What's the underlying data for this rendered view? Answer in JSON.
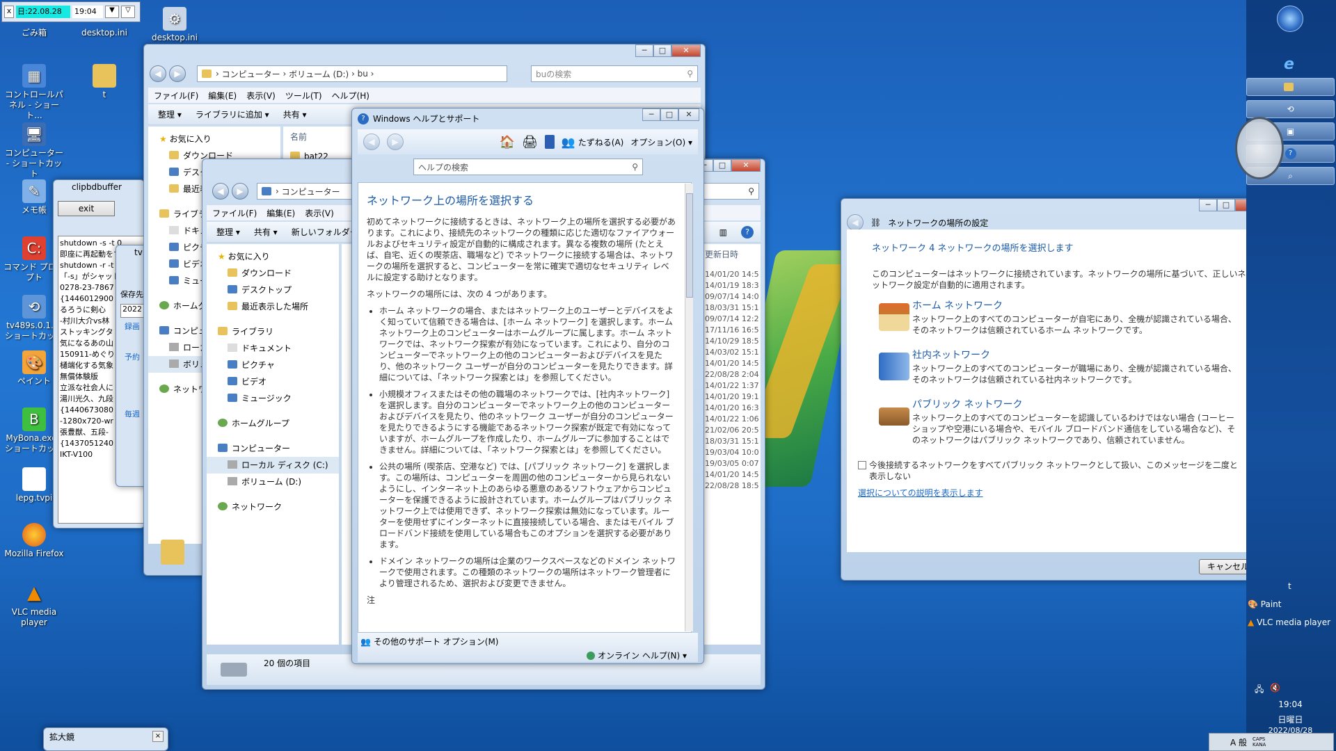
{
  "desktop": {
    "topbar": {
      "x_label": "x",
      "date": "日:22.08.28",
      "time": "19:04"
    },
    "icons": [
      {
        "label": "ごみ箱"
      },
      {
        "label": "desktop.ini"
      },
      {
        "label": "desktop.ini"
      },
      {
        "label": "コントロールパネル - ショート..."
      },
      {
        "label": "t"
      },
      {
        "label": "コンピューター - ショートカット"
      },
      {
        "label": "メモ帳"
      },
      {
        "label": "コマンド プロンプト"
      },
      {
        "label": "tv489s.0.1.. - ショートカット"
      },
      {
        "label": "ペイント"
      },
      {
        "label": "MyBona.exe - ショートカット"
      },
      {
        "label": "lepg.tvpi"
      },
      {
        "label": "Mozilla Firefox"
      },
      {
        "label": "VLC media player"
      }
    ]
  },
  "clip": {
    "title": "clipbdbuffer",
    "exit": "exit",
    "lines": [
      "shutdown -s -t 0",
      "即座に再起動をす",
      "shutdown -r -t 0",
      "「-s」がシャット",
      "0278-23-7867",
      "{1446012900",
      "るろうに剣心",
      "-村川大介vs林",
      "ストッキングタ",
      "気になるあの山",
      "150911-めぐり",
      "樋端化する気象",
      "無償体験版",
      "立派な社会人に",
      "湯川光久、九段",
      "{1440673080",
      "-1280x720-wr",
      "張豊猷、五段-",
      "{1437051240",
      "IKT-V100"
    ]
  },
  "tv": {
    "title": "tv",
    "hozon": "保存先",
    "year": "2022",
    "rokuga": "録画",
    "yoyaku": "予約",
    "maishu": "毎週"
  },
  "explorer1": {
    "path": [
      "コンピューター",
      "ボリューム (D:)",
      "bu"
    ],
    "search": "buの検索",
    "menu": [
      "ファイル(F)",
      "編集(E)",
      "表示(V)",
      "ツール(T)",
      "ヘルプ(H)"
    ],
    "cmd": [
      "整理 ▾",
      "ライブラリに追加 ▾",
      "共有 ▾"
    ],
    "nav": [
      "お気に入り",
      "ダウンロード",
      "デスクトップ",
      "最近表示した場所",
      "ライブラリ",
      "ドキュメント",
      "ピクチャ",
      "ビデオ",
      "ミュージック",
      "ホームグループ",
      "コンピューター",
      "ローカル ディスク (C:)",
      "ボリューム (D:)",
      "ネットワーク"
    ],
    "col": "名前",
    "file": "bat22"
  },
  "explorer2": {
    "path": "コンピューター",
    "menu": [
      "ファイル(F)",
      "編集(E)",
      "表示(V)"
    ],
    "cmd": [
      "整理 ▾",
      "共有 ▾",
      "新しいフォルダー"
    ],
    "nav": [
      "お気に入り",
      "ダウンロード",
      "デスクトップ",
      "最近表示した場所",
      "ライブラリ",
      "ドキュメント",
      "ピクチャ",
      "ビデオ",
      "ミュージック",
      "ホームグループ",
      "コンピューター",
      "ローカル ディスク (C:)",
      "ボリューム (D:)",
      "ネットワーク"
    ],
    "datecol": "更新日時",
    "dates": [
      "14/01/20 14:5",
      "14/01/19 18:3",
      "09/07/14 14:0",
      "18/03/31 15:1",
      "09/07/14 12:2",
      "17/11/16 16:5",
      "14/10/29 18:5",
      "14/03/02 15:1",
      "14/01/20 14:5",
      "22/08/28 2:04",
      "14/01/22 1:37",
      "14/01/20 19:1",
      "14/01/20 16:3",
      "14/01/22 1:06",
      "21/02/06 20:5",
      "18/03/31 15:1",
      "19/03/04 10:0",
      "19/03/05 0:07",
      "14/01/20 14:5",
      "22/08/28 18:5"
    ],
    "status": "20 個の項目"
  },
  "help": {
    "title": "Windows ヘルプとサポート",
    "ask": "たずねる(A)",
    "options": "オプション(O)",
    "search_placeholder": "ヘルプの検索",
    "heading": "ネットワーク上の場所を選択する",
    "intro": "初めてネットワークに接続するときは、ネットワーク上の場所を選択する必要があります。これにより、接続先のネットワークの種類に応じた適切なファイアウォールおよびセキュリティ設定が自動的に構成されます。異なる複数の場所 (たとえば、自宅、近くの喫茶店、職場など) でネットワークに接続する場合は、ネットワークの場所を選択すると、コンピューターを常に確実で適切なセキュリティ レベルに設定する助けとなります。",
    "four": "ネットワークの場所には、次の 4 つがあります。",
    "b1": "ホーム ネットワークの場合、またはネットワーク上のユーザーとデバイスをよく知っていて信頼できる場合は、[ホーム ネットワーク] を選択します。ホーム ネットワーク上のコンピューターはホームグループに属します。ホーム ネットワークでは、ネットワーク探索が有効になっています。これにより、自分のコンピューターでネットワーク上の他のコンピューターおよびデバイスを見たり、他のネットワーク ユーザーが自分のコンピューターを見たりできます。詳細については、「ネットワーク探索とは」を参照してください。",
    "b2": "小規模オフィスまたはその他の職場のネットワークでは、[社内ネットワーク] を選択します。自分のコンピューターでネットワーク上の他のコンピューターおよびデバイスを見たり、他のネットワーク ユーザーが自分のコンピューターを見たりできるようにする機能であるネットワーク探索が既定で有効になっていますが、ホームグループを作成したり、ホームグループに参加することはできません。詳細については、「ネットワーク探索とは」を参照してください。",
    "b3": "公共の場所 (喫茶店、空港など) では、[パブリック ネットワーク] を選択します。この場所は、コンピューターを周囲の他のコンピューターから見られないようにし、インターネット上のあらゆる悪意のあるソフトウェアからコンピューターを保護できるように設計されています。ホームグループはパブリック ネットワーク上では使用できず、ネットワーク探索は無効になっています。ルーターを使用せずにインターネットに直接接続している場合、またはモバイル ブロードバンド接続を使用している場合もこのオプションを選択する必要があります。",
    "b4": "ドメイン ネットワークの場所は企業のワークスペースなどのドメイン ネットワークで使用されます。この種類のネットワークの場所はネットワーク管理者により管理されるため、選択および変更できません。",
    "note": "注",
    "other_support": "その他のサポート オプション(M)",
    "online_help": "オンライン ヘルプ(N) ▾"
  },
  "netdlg": {
    "title": "ネットワークの場所の設定",
    "heading": "ネットワーク 4 ネットワークの場所を選択します",
    "intro1": "このコンピューターはネットワークに接続されています。ネットワークの場所に基づいて、正しいネ",
    "intro2": "ットワーク設定が自動的に適用されます。",
    "home_title": "ホーム ネットワーク",
    "home_d1": "ネットワーク上のすべてのコンピューターが自宅にあり、全機が認識されている場合、",
    "home_d2": "そのネットワークは信頼されているホーム ネットワークです。",
    "work_title": "社内ネットワーク",
    "work_d1": "ネットワーク上のすべてのコンピューターが職場にあり、全機が認識されている場合、",
    "work_d2": "そのネットワークは信頼されている社内ネットワークです。",
    "pub_title": "パブリック ネットワーク",
    "pub_d1": "ネットワーク上のすべてのコンピューターを認識しているわけではない場合 (コーヒー",
    "pub_d2": "ショップや空港にいる場合や、モバイル ブロードバンド通信をしている場合など)、そ",
    "pub_d3": "のネットワークはパブリック ネットワークであり、信頼されていません。",
    "checkbox1": "今後接続するネットワークをすべてパブリック ネットワークとして扱い、このメッセージを二度と",
    "checkbox2": "表示しない",
    "explain_link": "選択についての説明を表示します",
    "cancel": "キャンセル"
  },
  "magnifier": {
    "title": "拡大鏡"
  },
  "sidebar": {
    "items": [
      "t",
      "Paint",
      "VLC media player"
    ],
    "time": "19:04",
    "day": "日曜日",
    "date": "2022/08/28",
    "ime": "A 般",
    "caps": "CAPS KANA"
  },
  "colors": {
    "accent": "#1b5aa6",
    "link": "#1b69c9",
    "desktop": "#1e6cc6"
  }
}
